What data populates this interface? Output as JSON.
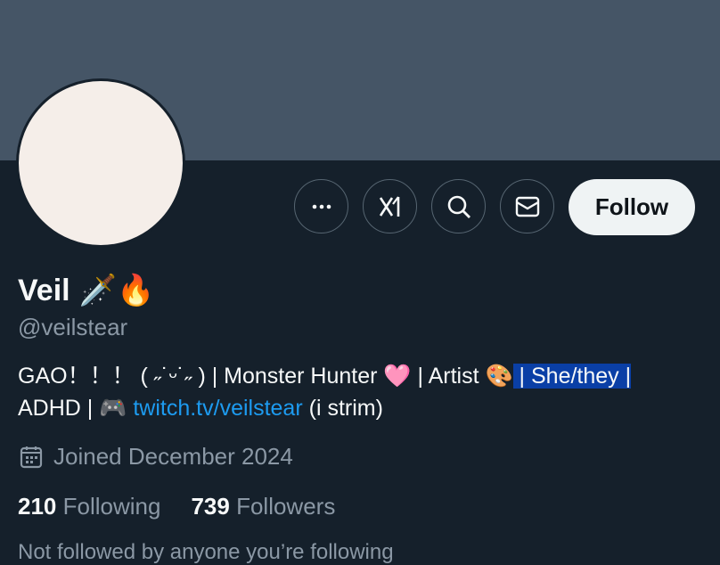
{
  "profile": {
    "name": "Veil",
    "name_emojis": [
      "🗡️",
      "🔥"
    ],
    "handle": "@veilstear",
    "bio": {
      "part1": "GAO！！！ ( ˶˙ᵕ˙˶ ) | Monster Hunter ",
      "heart": "🩷",
      "part2": " | Artist ",
      "palette": "🎨",
      "highlight": " | She/they |",
      "part3": "ADHD | ",
      "controller": "🎮",
      "link": "twitch.tv/veilstear",
      "part4": " (i strim)"
    },
    "joined": "Joined December 2024",
    "following_count": "210",
    "following_label": "Following",
    "followers_count": "739",
    "followers_label": "Followers",
    "not_followed": "Not followed by anyone you’re following"
  },
  "actions": {
    "more_icon": "more-icon",
    "grok_icon": "grok-icon",
    "search_icon": "search-icon",
    "message_icon": "message-icon",
    "follow_label": "Follow"
  },
  "colors": {
    "background": "#15202b",
    "banner": "#455566",
    "link": "#1d9bf0",
    "highlight": "#0a3fa6"
  }
}
